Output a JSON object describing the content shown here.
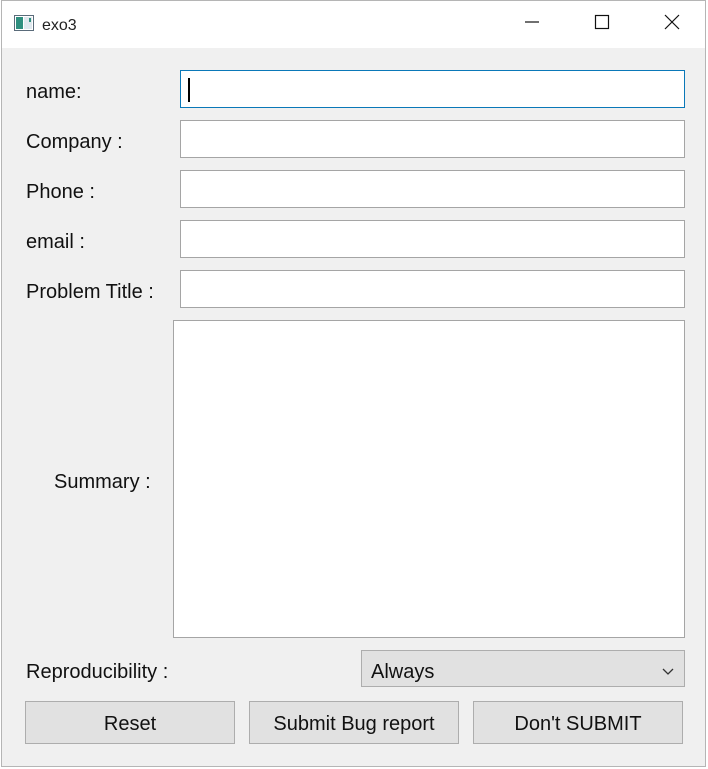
{
  "window": {
    "title": "exo3",
    "title_icon": "app-window-icon",
    "controls": [
      "minimize-icon",
      "maximize-icon",
      "close-icon"
    ]
  },
  "form": {
    "name_label": "name:",
    "name_value": "",
    "company_label": "Company :",
    "company_value": "",
    "phone_label": "Phone :",
    "phone_value": "",
    "email_label": "email :",
    "email_value": "",
    "problem_title_label": "Problem Title :",
    "problem_title_value": "",
    "summary_label": "Summary :",
    "summary_value": "",
    "reproducibility_label": "Reproducibility :",
    "reproducibility_value": "Always"
  },
  "buttons": {
    "reset": "Reset",
    "submit": "Submit Bug report",
    "dont_submit": "Don't SUBMIT"
  },
  "colors": {
    "focus_border": "#0a78b8",
    "window_bg": "#f0f0f0",
    "button_bg": "#e1e1e1"
  }
}
